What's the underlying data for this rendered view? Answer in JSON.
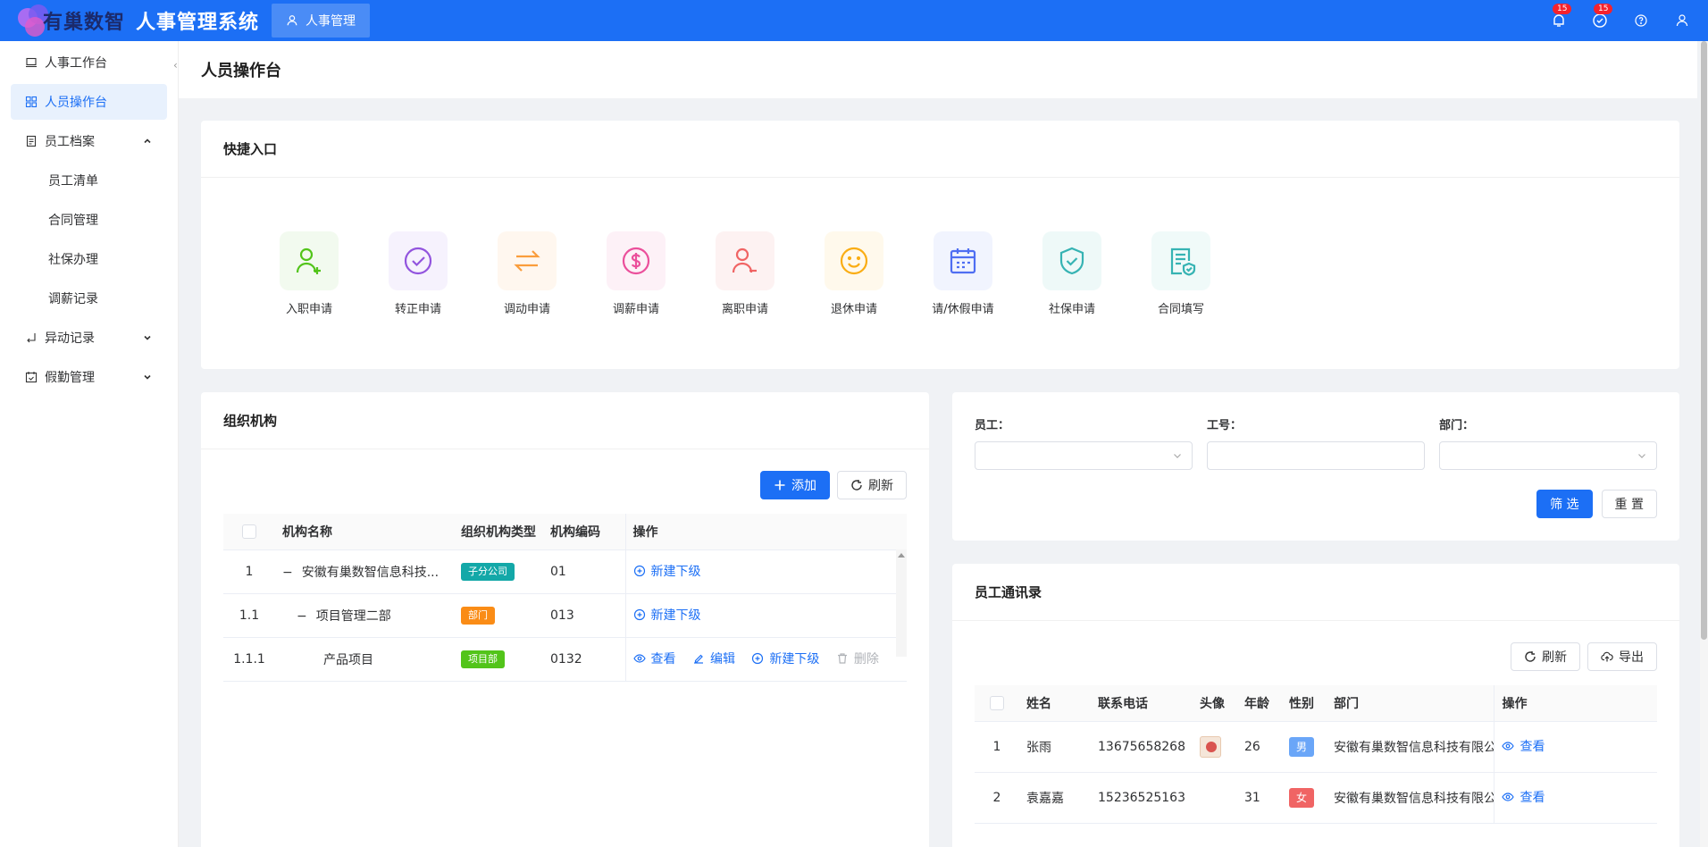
{
  "header": {
    "logo_text": "有巢数智",
    "system_title": "人事管理系统",
    "top_tab": "人事管理",
    "notif_badge": "15",
    "task_badge": "15"
  },
  "sidebar": {
    "items": [
      {
        "label": "人事工作台",
        "active": false
      },
      {
        "label": "人员操作台",
        "active": true
      },
      {
        "label": "员工档案",
        "expanded": true,
        "children": [
          "员工清单",
          "合同管理",
          "社保办理",
          "调薪记录"
        ]
      },
      {
        "label": "异动记录",
        "expanded": false
      },
      {
        "label": "假勤管理",
        "expanded": false
      }
    ]
  },
  "page": {
    "title": "人员操作台"
  },
  "quick": {
    "title": "快捷入口",
    "items": [
      {
        "label": "入职申请",
        "color": "#52c41a",
        "bg": "#f2faef"
      },
      {
        "label": "转正申请",
        "color": "#9254de",
        "bg": "#f6f2fd"
      },
      {
        "label": "调动申请",
        "color": "#fa9d3c",
        "bg": "#fff7ef"
      },
      {
        "label": "调薪申请",
        "color": "#eb4f9b",
        "bg": "#fdf1f7"
      },
      {
        "label": "离职申请",
        "color": "#f06464",
        "bg": "#fdf2f2"
      },
      {
        "label": "退休申请",
        "color": "#faad14",
        "bg": "#fff9ec"
      },
      {
        "label": "请/休假申请",
        "color": "#4f6ef2",
        "bg": "#f1f4fe"
      },
      {
        "label": "社保申请",
        "color": "#36b3b3",
        "bg": "#eef9f8"
      },
      {
        "label": "合同填写",
        "color": "#36b3b3",
        "bg": "#f0faf9"
      }
    ]
  },
  "org": {
    "title": "组织机构",
    "add_label": "添加",
    "refresh_label": "刷新",
    "columns": [
      "机构名称",
      "组织机构类型",
      "机构编码",
      "操作"
    ],
    "rows": [
      {
        "index": "1",
        "name": "安徽有巢数智信息科技...",
        "type": "子分公司",
        "type_color": "#13a8a8",
        "code": "01",
        "indent": 0,
        "expand": "−",
        "actions": [
          "新建下级"
        ]
      },
      {
        "index": "1.1",
        "name": "项目管理二部",
        "type": "部门",
        "type_color": "#fa8c16",
        "code": "013",
        "indent": 1,
        "expand": "−",
        "actions": [
          "新建下级"
        ]
      },
      {
        "index": "1.1.1",
        "name": "产品项目",
        "type": "项目部",
        "type_color": "#52c41a",
        "code": "0132",
        "indent": 2,
        "expand": "",
        "actions": [
          "查看",
          "编辑",
          "新建下级",
          "删除"
        ]
      }
    ]
  },
  "filter": {
    "employee_label": "员工：",
    "jobno_label": "工号：",
    "dept_label": "部门：",
    "filter_btn": "筛 选",
    "reset_btn": "重 置"
  },
  "contacts": {
    "title": "员工通讯录",
    "refresh_label": "刷新",
    "export_label": "导出",
    "columns": [
      "姓名",
      "联系电话",
      "头像",
      "年龄",
      "性别",
      "部门",
      "操作"
    ],
    "rows": [
      {
        "index": "1",
        "name": "张雨",
        "phone": "13675658268",
        "has_avatar": true,
        "age": "26",
        "gender": "男",
        "gender_color": "#6aa6f8",
        "dept": "安徽有巢数智信息科技有限公",
        "action": "查看"
      },
      {
        "index": "2",
        "name": "袁嘉嘉",
        "phone": "15236525163",
        "has_avatar": false,
        "age": "31",
        "gender": "女",
        "gender_color": "#f06464",
        "dept": "安徽有巢数智信息科技有限公",
        "action": "查看"
      }
    ]
  }
}
